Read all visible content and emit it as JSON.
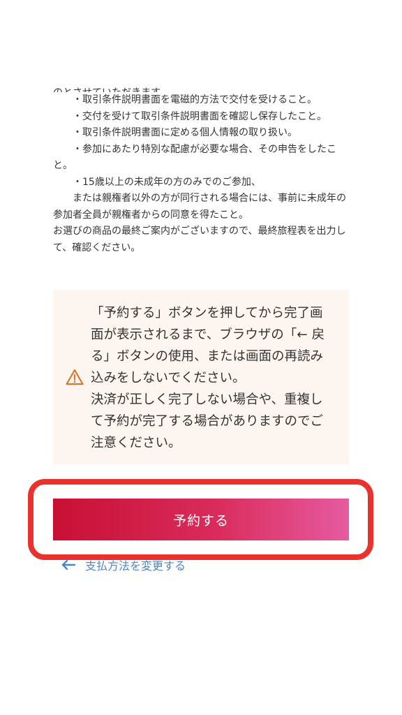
{
  "terms": {
    "cut_line": "のとさせていただきます。",
    "lines": [
      "　　・取引条件説明書面を電磁的方法で交付を受けること。",
      "　　・交付を受けて取引条件説明書面を確認し保存したこと。",
      "　　・取引条件説明書面に定める個人情報の取り扱い。",
      "　　・参加にあたり特別な配慮が必要な場合、その申告をしたこと。",
      "　　・15歳以上の未成年の方のみでのご参加、\n　　または親権者以外の方が同行される場合には、事前に未成年の参加者全員が親権者からの同意を得たこと。",
      "お選びの商品の最終ご案内がございますので、最終旅程表を出力して、確認ください。"
    ]
  },
  "warning": {
    "icon": "warning-triangle-icon",
    "text": "「予約する」ボタンを押してから完了画面が表示されるまで、ブラウザの「← 戻る」ボタンの使用、または画面の再読み込みをしないでください。\n決済が正しく完了しない場合や、重複して予約が完了する場合がありますのでご注意ください。"
  },
  "actions": {
    "reserve_label": "予約する",
    "change_payment_label": "支払方法を変更する"
  },
  "colors": {
    "button_gradient_start": "#c81033",
    "button_gradient_end": "#e65b9f",
    "highlight_frame": "#e8322d",
    "link": "#4a87c8",
    "warning_bg": "#fdf6f0",
    "warning_icon": "#d9762b"
  }
}
